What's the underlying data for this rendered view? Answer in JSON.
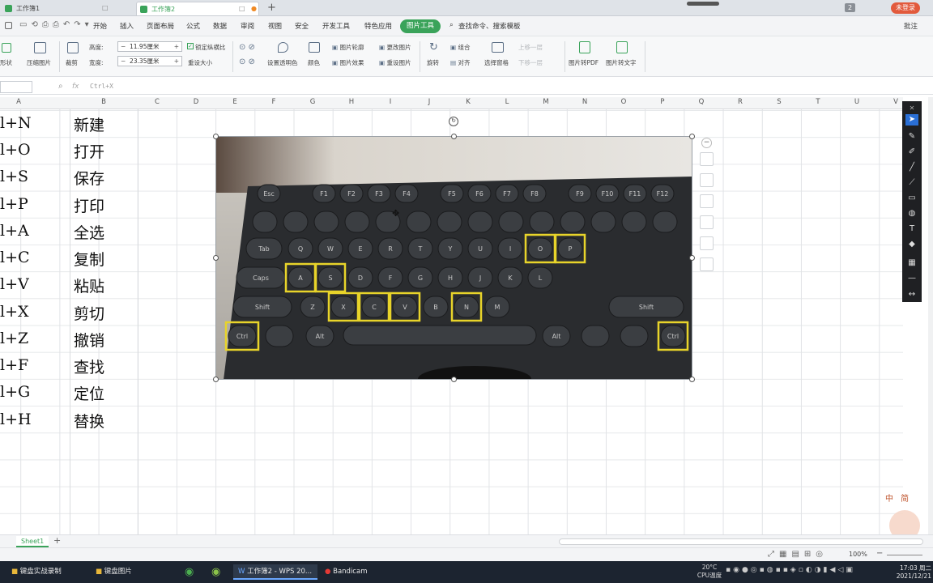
{
  "titlebar": {
    "tabs": [
      {
        "label": "工作簿1"
      },
      {
        "label": "工作簿2"
      }
    ],
    "page_number": "2",
    "login_button": "未登录"
  },
  "menu": {
    "items": [
      "开始",
      "插入",
      "页面布局",
      "公式",
      "数据",
      "审阅",
      "视图",
      "安全",
      "开发工具",
      "特色应用"
    ],
    "active": "图片工具",
    "search": "查找命令、搜索模板",
    "comment": "批注"
  },
  "ribbon": {
    "shape_label": "形状",
    "compress": "压缩图片",
    "crop": "裁剪",
    "height_label": "高度:",
    "height_value": "11.95厘米",
    "width_label": "宽度:",
    "width_value": "23.35厘米",
    "lock_ratio": "锁定纵横比",
    "reset_size": "重设大小",
    "set_transparent": "设置透明色",
    "color": "颜色",
    "outline": "图片轮廓",
    "effects": "图片效果",
    "change_pic": "更改图片",
    "reset_pic": "重设图片",
    "rotate": "旋转",
    "group": "组合",
    "align": "对齐",
    "select_pane": "选择窗格",
    "bring_forward": "上移一层",
    "send_backward": "下移一层",
    "to_pdf": "图片转PDF",
    "to_text": "图片转文字"
  },
  "formula": {
    "fx": "fx",
    "content": "Ctrl+X"
  },
  "columns": [
    "A",
    "B",
    "C",
    "D",
    "E",
    "F",
    "G",
    "H",
    "I",
    "J",
    "K",
    "L",
    "M",
    "N",
    "O",
    "P",
    "Q",
    "R",
    "S",
    "T",
    "U",
    "V"
  ],
  "rows": [
    {
      "a": "l+N",
      "b": "新建"
    },
    {
      "a": "l+O",
      "b": "打开"
    },
    {
      "a": "l+S",
      "b": "保存"
    },
    {
      "a": "l+P",
      "b": "打印"
    },
    {
      "a": "l+A",
      "b": "全选"
    },
    {
      "a": "l+C",
      "b": "复制"
    },
    {
      "a": "l+V",
      "b": "粘贴"
    },
    {
      "a": "l+X",
      "b": "剪切"
    },
    {
      "a": "l+Z",
      "b": "撤销"
    },
    {
      "a": "l+F",
      "b": "查找"
    },
    {
      "a": "l+G",
      "b": "定位"
    },
    {
      "a": "l+H",
      "b": "替换"
    }
  ],
  "keyboard": {
    "fn_keys": [
      "Esc",
      "F1",
      "F2",
      "F3",
      "F4",
      "F5",
      "F6",
      "F7",
      "F8",
      "F9",
      "F10",
      "F11",
      "F12"
    ],
    "row_q": [
      "Tab",
      "Q",
      "W",
      "E",
      "R",
      "T",
      "Y",
      "U",
      "I",
      "O",
      "P"
    ],
    "row_a": [
      "Caps",
      "A",
      "S",
      "D",
      "F",
      "G",
      "H",
      "J",
      "K",
      "L"
    ],
    "row_z": [
      "Shift",
      "Z",
      "X",
      "C",
      "V",
      "B",
      "N",
      "M",
      "Shift"
    ],
    "row_ctrl": [
      "Ctrl",
      "Alt",
      "Alt",
      "Ctrl"
    ],
    "highlighted": [
      "O",
      "P",
      "A",
      "S",
      "X",
      "C",
      "V",
      "N",
      "Ctrl",
      "Ctrl"
    ],
    "highlight_color": "#e8d42a"
  },
  "sheet": {
    "name": "Sheet1",
    "add": "+"
  },
  "status": {
    "zoom": "100%"
  },
  "watermark": "中 简",
  "taskbar": {
    "items": [
      "键盘实战录制",
      "键盘图片",
      "工作簿2 - WPS 20...",
      "Bandicam"
    ],
    "weather_temp": "20°C",
    "weather_label": "CPU温度",
    "time": "17:03 周二",
    "date": "2021/12/21"
  },
  "colors": {
    "accent": "#3aa35a",
    "taskbar": "#1c2430"
  }
}
